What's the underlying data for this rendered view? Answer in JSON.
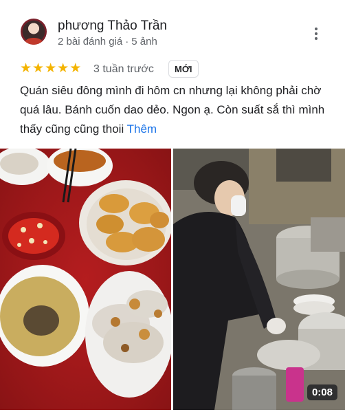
{
  "reviewer": {
    "name": "phương Thảo Trần",
    "review_count": "2 bài đánh giá",
    "photo_count": "5 ảnh"
  },
  "review": {
    "rating": 5,
    "time": "3 tuần trước",
    "badge": "MỚI",
    "text": "Quán siêu đông mình đi hôm cn nhưng lại không phải chờ quá lâu. Bánh cuốn dao dẻo. Ngon ạ. Còn suất sắ thì mình thấy cũng cũng thoii",
    "more_label": "Thêm"
  },
  "media": {
    "video_duration": "0:08"
  },
  "colors": {
    "star": "#f4b400",
    "link": "#1a73e8",
    "secondary_text": "#5f6368"
  }
}
